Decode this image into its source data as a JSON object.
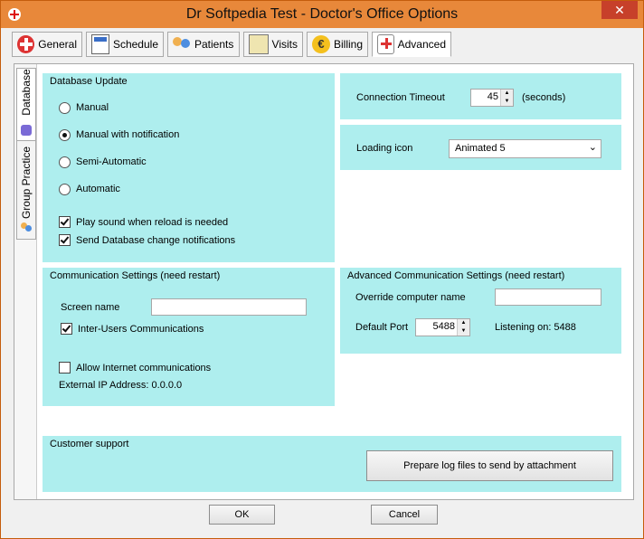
{
  "window": {
    "title": "Dr Softpedia Test - Doctor's Office Options",
    "close": "✕"
  },
  "tabs": [
    {
      "label": "General"
    },
    {
      "label": "Schedule"
    },
    {
      "label": "Patients"
    },
    {
      "label": "Visits"
    },
    {
      "label": "Billing"
    },
    {
      "label": "Advanced",
      "active": true
    }
  ],
  "side_tabs": [
    {
      "label": "Database",
      "active": true
    },
    {
      "label": "Group Practice"
    }
  ],
  "database_update": {
    "title": "Database Update",
    "options": [
      "Manual",
      "Manual with notification",
      "Semi-Automatic",
      "Automatic"
    ],
    "selected": "Manual with notification",
    "play_sound": {
      "label": "Play sound when reload is needed",
      "checked": true
    },
    "send_notifications": {
      "label": "Send Database change notifications",
      "checked": true
    }
  },
  "connection": {
    "label": "Connection Timeout",
    "value": "45",
    "unit": "(seconds)"
  },
  "loading": {
    "label": "Loading icon",
    "value": "Animated 5"
  },
  "communication": {
    "title": "Communication Settings (need restart)",
    "screen_name_label": "Screen name",
    "screen_name_value": "",
    "inter_users": {
      "label": "Inter-Users Communications",
      "checked": true
    },
    "allow_internet": {
      "label": "Allow Internet communications",
      "checked": false
    },
    "external_ip": "External IP Address: 0.0.0.0"
  },
  "advanced_comm": {
    "title": "Advanced Communication Settings (need restart)",
    "override_label": "Override computer name",
    "override_value": "",
    "port_label": "Default Port",
    "port_value": "5488",
    "listening": "Listening on: 5488"
  },
  "support": {
    "title": "Customer support",
    "button": "Prepare log files to send by attachment"
  },
  "footer": {
    "ok": "OK",
    "cancel": "Cancel"
  },
  "colors": {
    "titlebar": "#e8883a",
    "panel": "#aeeeee",
    "close": "#c7402a"
  },
  "icons": {
    "general": "red-cross-icon",
    "schedule": "calendar-clock-icon",
    "patients": "people-icon",
    "visits": "clipboard-icon",
    "billing": "euro-coin-icon",
    "advanced": "medical-kit-icon",
    "database": "database-icon",
    "group": "group-people-icon"
  }
}
